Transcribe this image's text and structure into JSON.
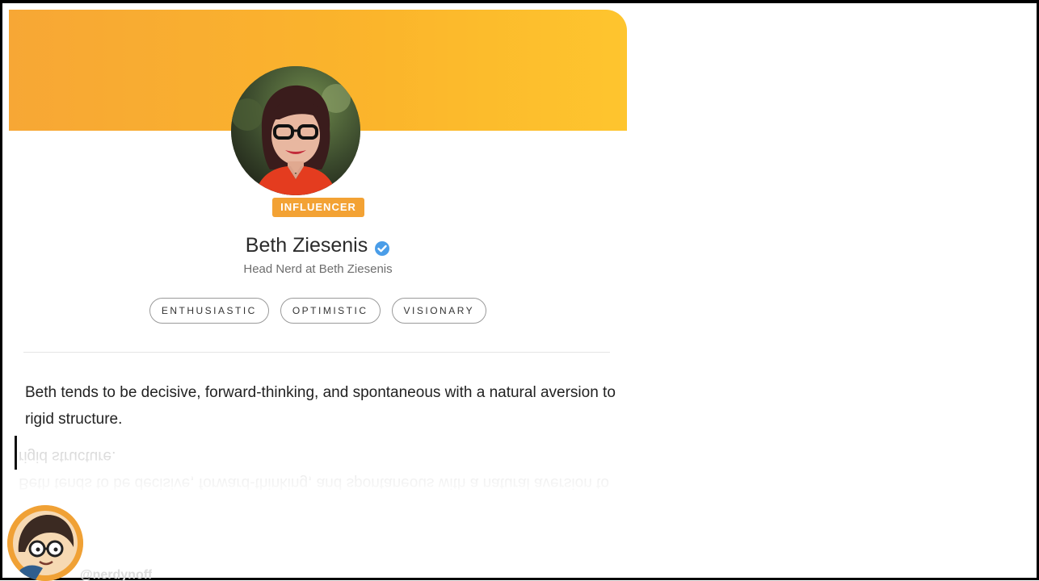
{
  "profile": {
    "badge": "INFLUENCER",
    "name": "Beth Ziesenis",
    "headline": "Head Nerd at Beth Ziesenis",
    "traits": [
      "ENTHUSIASTIC",
      "OPTIMISTIC",
      "VISIONARY"
    ],
    "description": "Beth tends to be decisive, forward-thinking, and spontaneous with a natural aversion to rigid structure."
  },
  "presenter": {
    "handle": "@nerdynoff"
  },
  "colors": {
    "banner_start": "#f7a735",
    "banner_end": "#fec52e",
    "badge": "#f3a234",
    "verified": "#4a9de8"
  },
  "icons": {
    "verified": "verified-check-icon",
    "avatar": "profile-photo",
    "presenter": "cartoon-avatar"
  }
}
